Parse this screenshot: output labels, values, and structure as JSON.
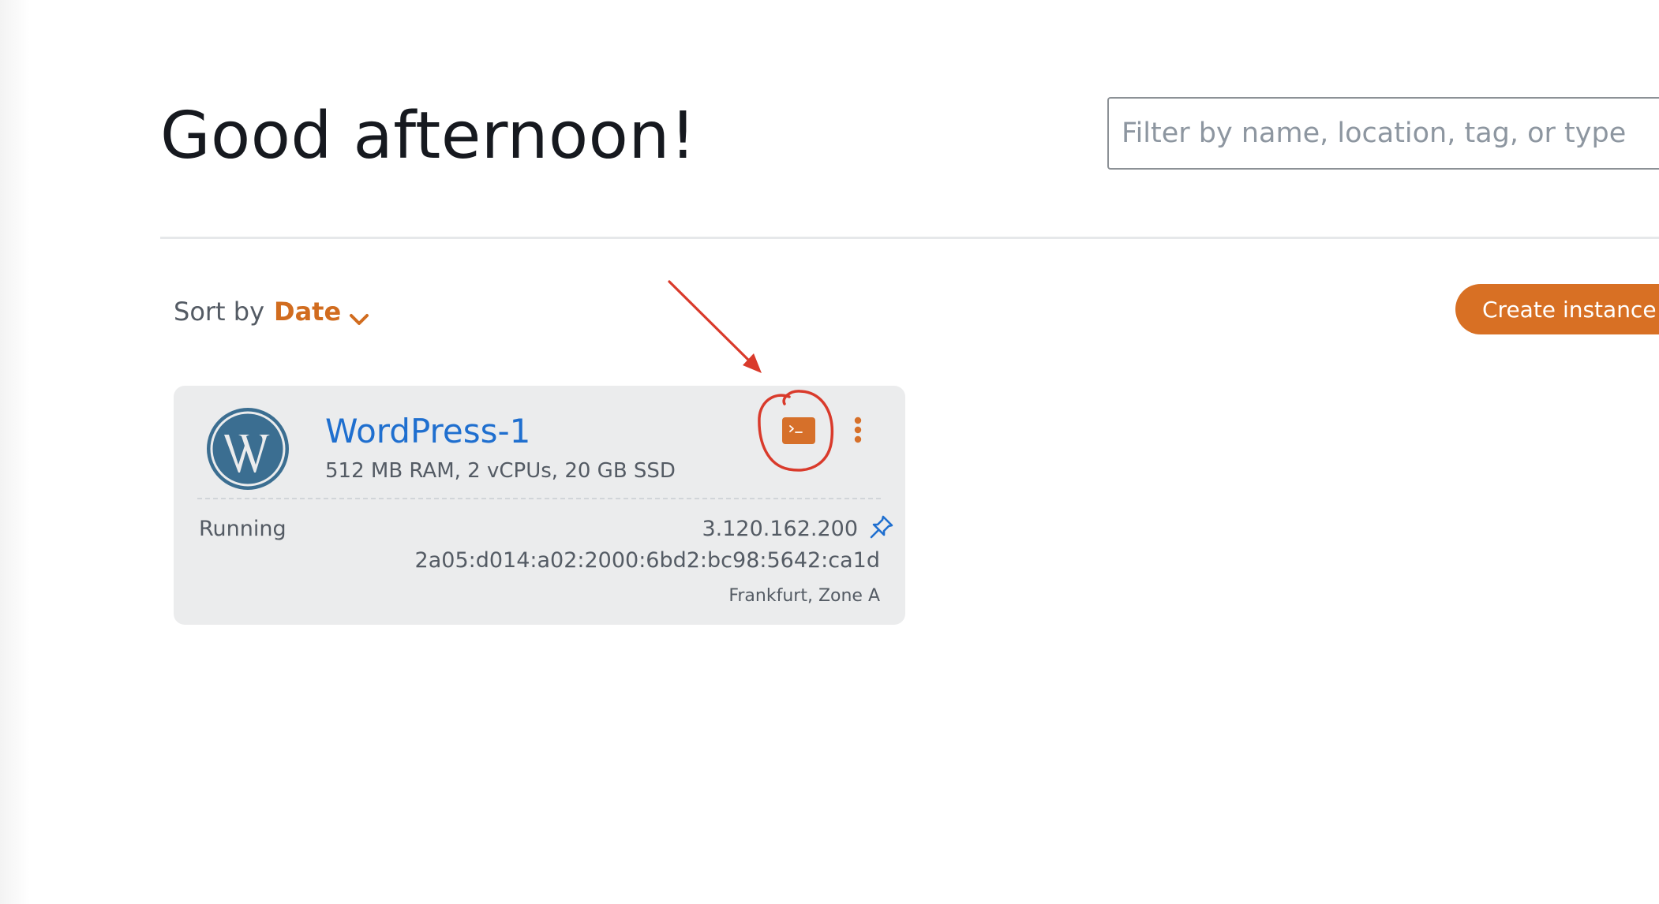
{
  "greeting": "Good afternoon!",
  "filter": {
    "placeholder": "Filter by name, location, tag, or type",
    "value": ""
  },
  "sort": {
    "label": "Sort by",
    "value": "Date"
  },
  "create_button": "Create instance",
  "instance": {
    "name": "WordPress-1",
    "spec": "512 MB RAM, 2 vCPUs, 20 GB SSD",
    "status": "Running",
    "ipv4": "3.120.162.200",
    "ipv6": "2a05:d014:a02:2000:6bd2:bc98:5642:ca1d",
    "location": "Frankfurt, Zone A",
    "logo_icon": "wordpress-logo",
    "connect_icon": "terminal-icon",
    "menu_icon": "kebab-menu-icon",
    "pin_icon": "pin-icon"
  },
  "colors": {
    "accent": "#d87024",
    "link": "#1f6fcf",
    "card_bg": "#ebeced",
    "annotation": "#d93a2b"
  }
}
